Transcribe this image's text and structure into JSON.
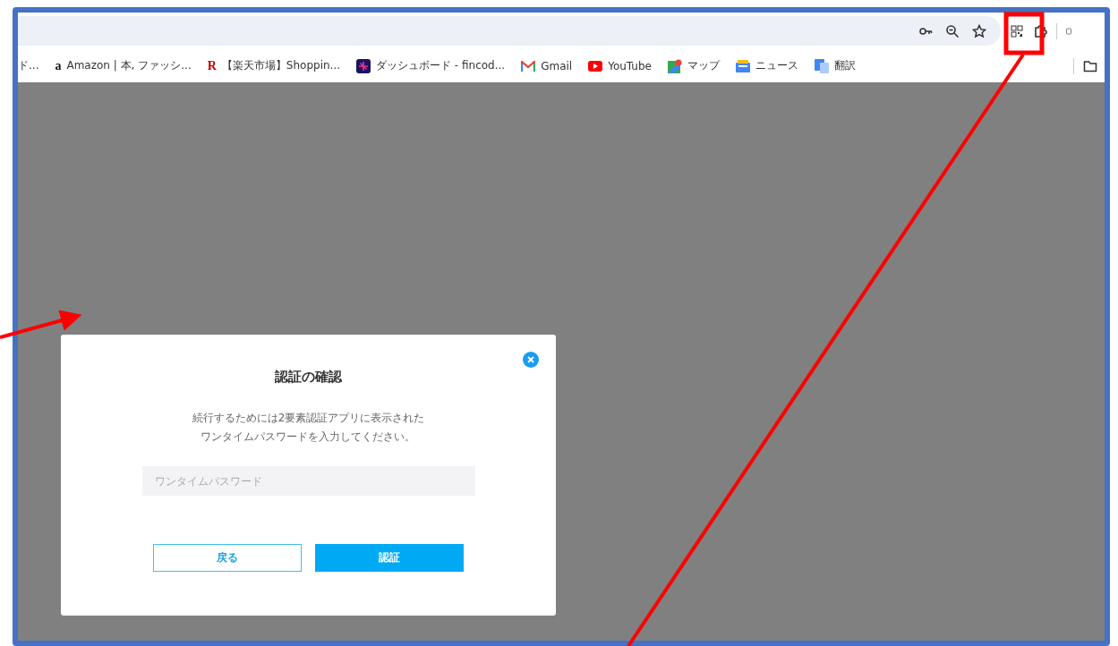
{
  "bookmarks": [
    {
      "label": "ド...",
      "kind": "none"
    },
    {
      "label": "Amazon | 本, ファッシ...",
      "kind": "letter",
      "icon_text": "a"
    },
    {
      "label": "【楽天市場】Shoppin...",
      "kind": "letter",
      "icon_text": "R"
    },
    {
      "label": "ダッシュボード - fincod...",
      "kind": "square"
    },
    {
      "label": "Gmail",
      "kind": "mail"
    },
    {
      "label": "YouTube",
      "kind": "play"
    },
    {
      "label": "マップ",
      "kind": "pin"
    },
    {
      "label": "ニュース",
      "kind": "news"
    },
    {
      "label": "翻訳",
      "kind": "translate"
    }
  ],
  "dialog": {
    "title": "認証の確認",
    "message_lines": [
      "続行するためには2要素認証アプリに表示された",
      "ワンタイムパスワードを入力してください。"
    ],
    "placeholder": "ワンタイムパスワード",
    "buttons": [
      {
        "label": "戻る",
        "kind": "outline"
      },
      {
        "label": "認証",
        "kind": "primary"
      }
    ]
  }
}
